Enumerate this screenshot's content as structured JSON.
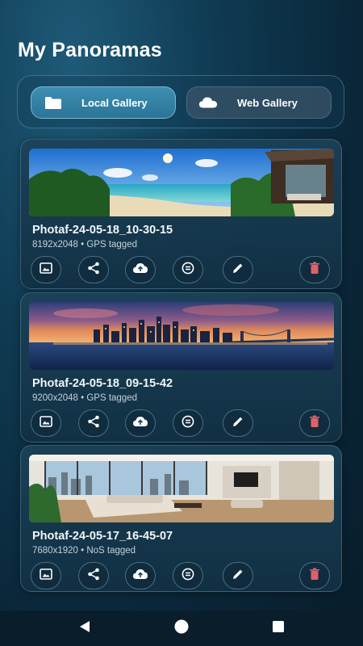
{
  "header": {
    "title": "My Panoramas"
  },
  "tabs": [
    {
      "label": "Local Gallery",
      "icon": "folder-icon",
      "selected": true
    },
    {
      "label": "Web Gallery",
      "icon": "cloud-icon",
      "selected": false
    }
  ],
  "panoramas": [
    {
      "name": "Photaf-24-05-18_10-30-15",
      "meta": "8192x2048 • GPS tagged",
      "thumbnail": "beach-panorama"
    },
    {
      "name": "Photaf-24-05-18_09-15-42",
      "meta": "9200x2048 • GPS tagged",
      "thumbnail": "city-skyline-panorama"
    },
    {
      "name": "Photaf-24-05-17_16-45-07",
      "meta": "7680x1920 • NoS tagged",
      "thumbnail": "living-room-panorama"
    }
  ],
  "card_actions": [
    "image-icon",
    "share-icon",
    "cloud-upload-icon",
    "equal-circle-icon",
    "edit-icon",
    "delete-icon"
  ],
  "colors": {
    "accent": "#3a8ab0",
    "delete": "#e0606a",
    "background": "#0f3a52"
  },
  "navbar": {
    "buttons": [
      "back-icon",
      "home-icon",
      "recents-icon"
    ]
  }
}
